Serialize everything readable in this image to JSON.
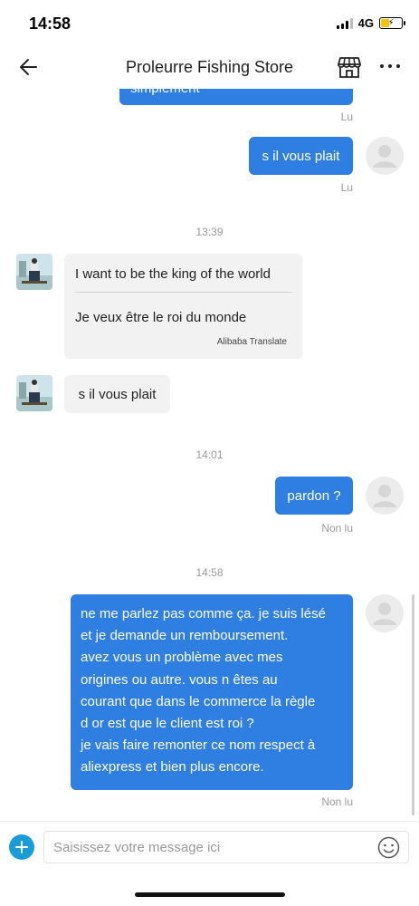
{
  "status_bar": {
    "time": "14:58",
    "network": "4G"
  },
  "header": {
    "title": "Proleurre Fishing Store"
  },
  "messages": {
    "cut_text": "simplement",
    "read_label_1": "Lu",
    "out_1": "s il vous plait",
    "read_label_2": "Lu",
    "time_1": "13:39",
    "in_1_original": "I want to be the king of the world",
    "in_1_translated": "Je veux être le roi du monde",
    "in_1_translator": "Alibaba Translate",
    "in_2": "s il vous plait",
    "time_2": "14:01",
    "out_2": "pardon ?",
    "unread_label_1": "Non lu",
    "time_3": "14:58",
    "out_3_lines": [
      "ne me parlez pas comme ça. je suis lésé",
      "et je demande un remboursement.",
      "avez vous un problème avec mes",
      "origines ou autre. vous n êtes au",
      "courant que dans le commerce la règle",
      "d or est que le client est roi ?",
      "je vais faire remonter ce nom respect à",
      "aliexpress et bien plus encore."
    ],
    "unread_label_2": "Non lu"
  },
  "input": {
    "placeholder": "Saisissez votre message ici"
  },
  "colors": {
    "outgoing_bubble": "#2f7fe2",
    "incoming_bubble": "#f2f2f2",
    "add_button": "#1a9cd8"
  },
  "icons": [
    "back-arrow-icon",
    "store-icon",
    "more-icon",
    "plus-icon",
    "emoji-icon",
    "default-avatar-icon",
    "store-avatar"
  ]
}
